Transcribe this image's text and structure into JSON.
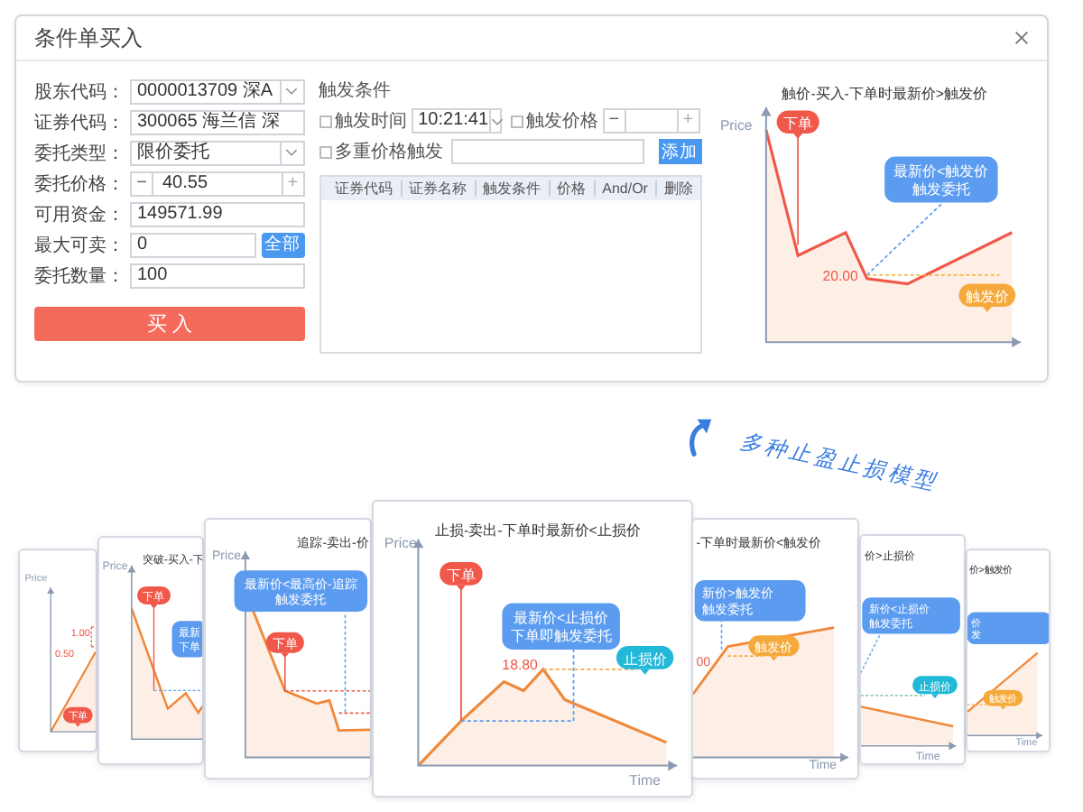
{
  "window": {
    "title": "条件单买入"
  },
  "form": {
    "rows": [
      {
        "label": "股东代码：",
        "kind": "select",
        "value": "0000013709  深A"
      },
      {
        "label": "证券代码：",
        "kind": "text",
        "value": "300065 海兰信  深"
      },
      {
        "label": "委托类型：",
        "kind": "select",
        "value": "限价委托"
      },
      {
        "label": "委托价格：",
        "kind": "stepper",
        "value": "40.55",
        "minus": "−",
        "plus": "+"
      },
      {
        "label": "可用资金：",
        "kind": "text",
        "value": "149571.99"
      },
      {
        "label": "最大可卖：",
        "kind": "button",
        "value": "0",
        "button": "全部"
      },
      {
        "label": "委托数量：",
        "kind": "text",
        "value": "100"
      }
    ],
    "submit": "买 入"
  },
  "trigger": {
    "title": "触发条件",
    "time": {
      "label": "触发时间",
      "checked": false,
      "value": "10:21:41"
    },
    "price": {
      "label": "触发价格",
      "checked": false,
      "minus": "−",
      "plus": "+"
    },
    "multi": {
      "label": "多重价格触发",
      "checked": false
    },
    "add": "添加",
    "columns": [
      "证券代码",
      "证券名称",
      "触发条件",
      "价格",
      "And/Or",
      "删除"
    ]
  },
  "chart": {
    "title": "触价-买入-下单时最新价>触发价",
    "y_label": "Price",
    "order_tag": "下单",
    "callout": [
      "最新价<触发价",
      "触发委托"
    ],
    "price_labels": [
      "20.00"
    ],
    "level_tag": {
      "text": "触发价",
      "kind": "trigger"
    }
  },
  "slogan": "多种止盈止损模型",
  "cards": [
    {
      "y_label": "Price",
      "order_tag": "下单",
      "price_labels": [
        "1.00",
        "0.50"
      ]
    },
    {
      "title": "突破-买入-下",
      "y_label": "Price",
      "order_tag": "下单",
      "callout": [
        "最新",
        "下单"
      ]
    },
    {
      "title": "追踪-卖出-价",
      "y_label": "Price",
      "order_tag": "下单",
      "callout": [
        "最新价<最高价-追踪",
        "触发委托"
      ]
    },
    {
      "title": "止损-卖出-下单时最新价<止损价",
      "y_label": "Price",
      "x_label": "Time",
      "order_tag": "下单",
      "callout": [
        "最新价<止损价",
        "下单即触发委托"
      ],
      "price_labels": [
        "18.80"
      ],
      "level_tag": {
        "text": "止损价",
        "kind": "stop"
      }
    },
    {
      "title": "-下单时最新价<触发价",
      "x_label": "Time",
      "callout": [
        "新价>触发价",
        "触发委托"
      ],
      "price_labels": [
        "00"
      ],
      "level_tag": {
        "text": "触发价",
        "kind": "trigger"
      }
    },
    {
      "title": "价>止损价",
      "x_label": "Time",
      "callout": [
        "新价<止损价",
        "触发委托"
      ],
      "level_tag": {
        "text": "止损价",
        "kind": "stop"
      }
    },
    {
      "title": "价>触发价",
      "x_label": "Time",
      "callout": [
        "价",
        "发"
      ],
      "level_tag": {
        "text": "触发价",
        "kind": "trigger"
      }
    }
  ]
}
